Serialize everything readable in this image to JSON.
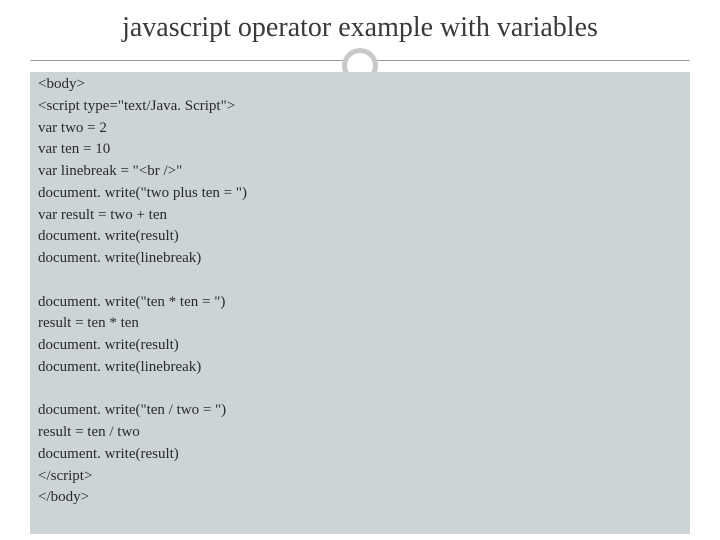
{
  "title": "javascript operator example with variables",
  "code": {
    "l0": "<body>",
    "l1": "<script type=\"text/Java. Script\">",
    "l2": "var two = 2",
    "l3": "var ten = 10",
    "l4": "var linebreak = \"<br />\"",
    "l5": "document. write(\"two plus ten = \")",
    "l6": "var result = two + ten",
    "l7": "document. write(result)",
    "l8": "document. write(linebreak)",
    "l9": "document. write(\"ten * ten = \")",
    "l10": "result = ten * ten",
    "l11": "document. write(result)",
    "l12": "document. write(linebreak)",
    "l13": "document. write(\"ten / two = \")",
    "l14": "result = ten / two",
    "l15": "document. write(result)",
    "l16": "</script>",
    "l17": "</body>"
  }
}
